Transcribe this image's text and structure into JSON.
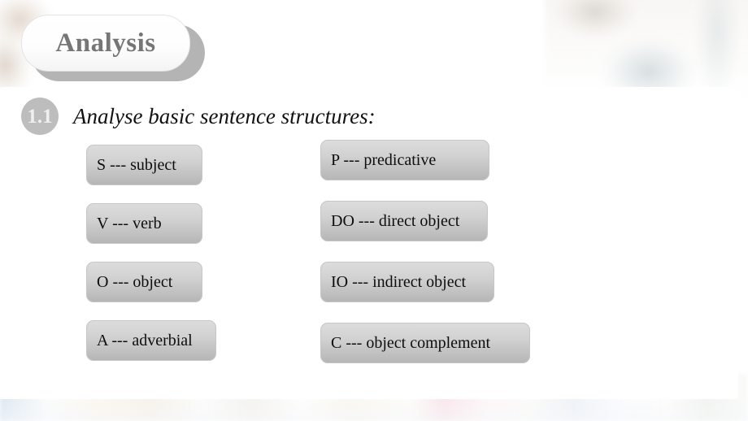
{
  "slide": {
    "title": "Analysis",
    "step_number": "1.1",
    "heading": "Analyse basic sentence structures:",
    "colors": {
      "title_text": "#767676",
      "badge_fill": "#bdbdbd",
      "badge_text": "#efefef",
      "box_fill_top": "#dcdcdc",
      "box_fill_bottom": "#b6b6b6",
      "box_text": "#0d0d0d",
      "panel_background": "#ffffff"
    }
  },
  "terms": {
    "left_column": [
      {
        "label": "S --- subject"
      },
      {
        "label": "V --- verb"
      },
      {
        "label": "O --- object"
      },
      {
        "label": "A --- adverbial"
      }
    ],
    "right_column": [
      {
        "label": "P  --- predicative"
      },
      {
        "label": "DO --- direct object"
      },
      {
        "label": "IO --- indirect object"
      },
      {
        "label": "C --- object complement"
      }
    ]
  }
}
